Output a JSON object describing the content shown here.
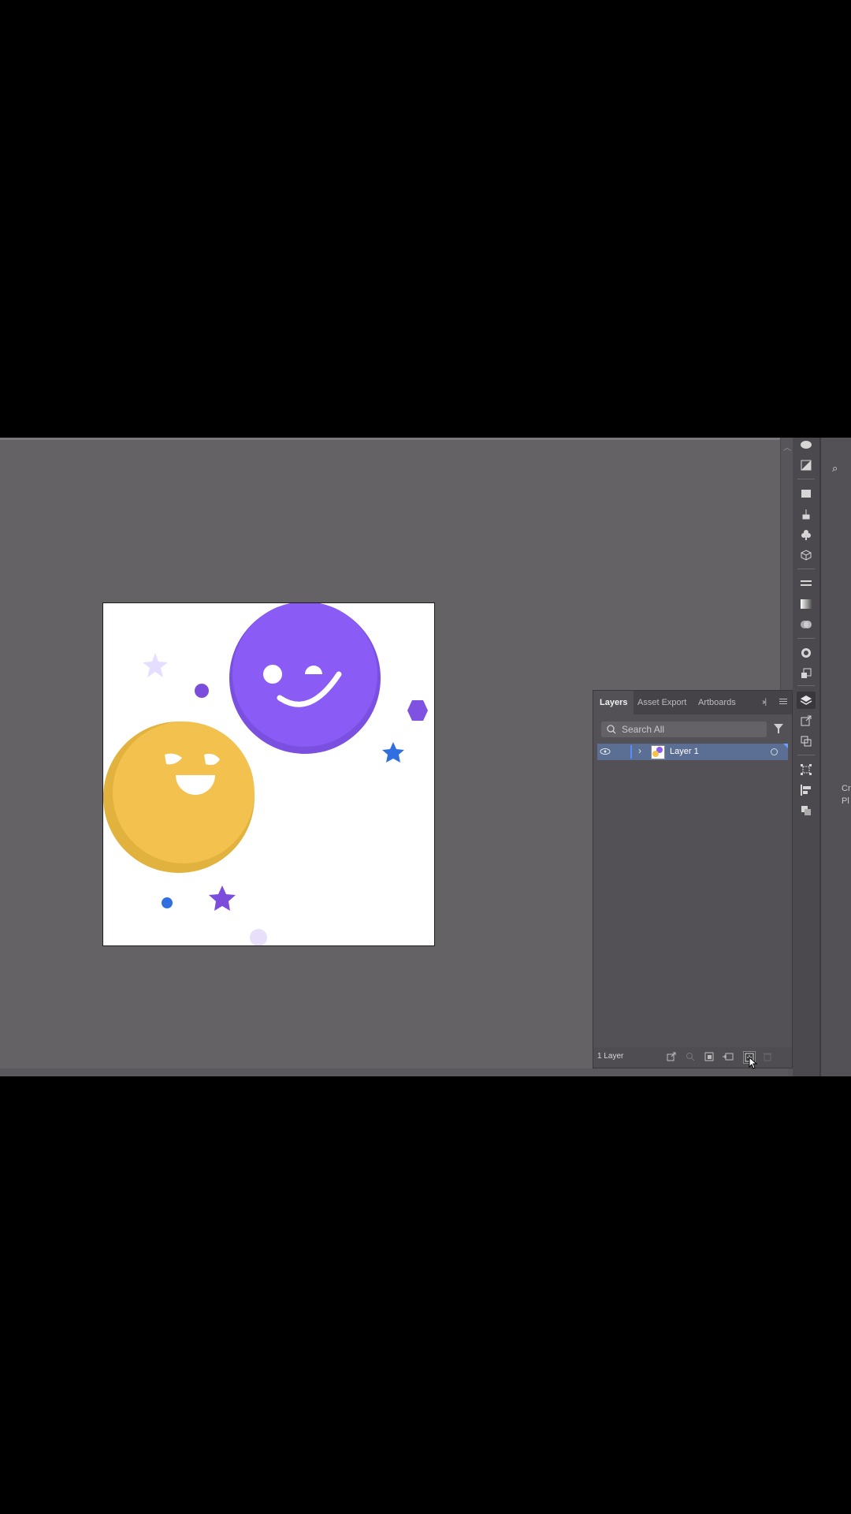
{
  "layers_panel": {
    "tabs": [
      "Layers",
      "Asset Export",
      "Artboards"
    ],
    "search_placeholder": "Search All",
    "layer_name": "Layer 1",
    "footer_count": "1 Layer"
  },
  "right_panel": {
    "truncated_text_1": "Cr",
    "truncated_text_2": "Pl"
  },
  "colors": {
    "purple": "#8b5cf0",
    "yellow": "#f2c14e",
    "blue": "#2f6fe0",
    "selection": "#5a6f93"
  },
  "icons": {
    "eye": "eye-icon",
    "search": "search-icon",
    "filter": "filter-icon",
    "new_layer": "new-layer-icon"
  }
}
